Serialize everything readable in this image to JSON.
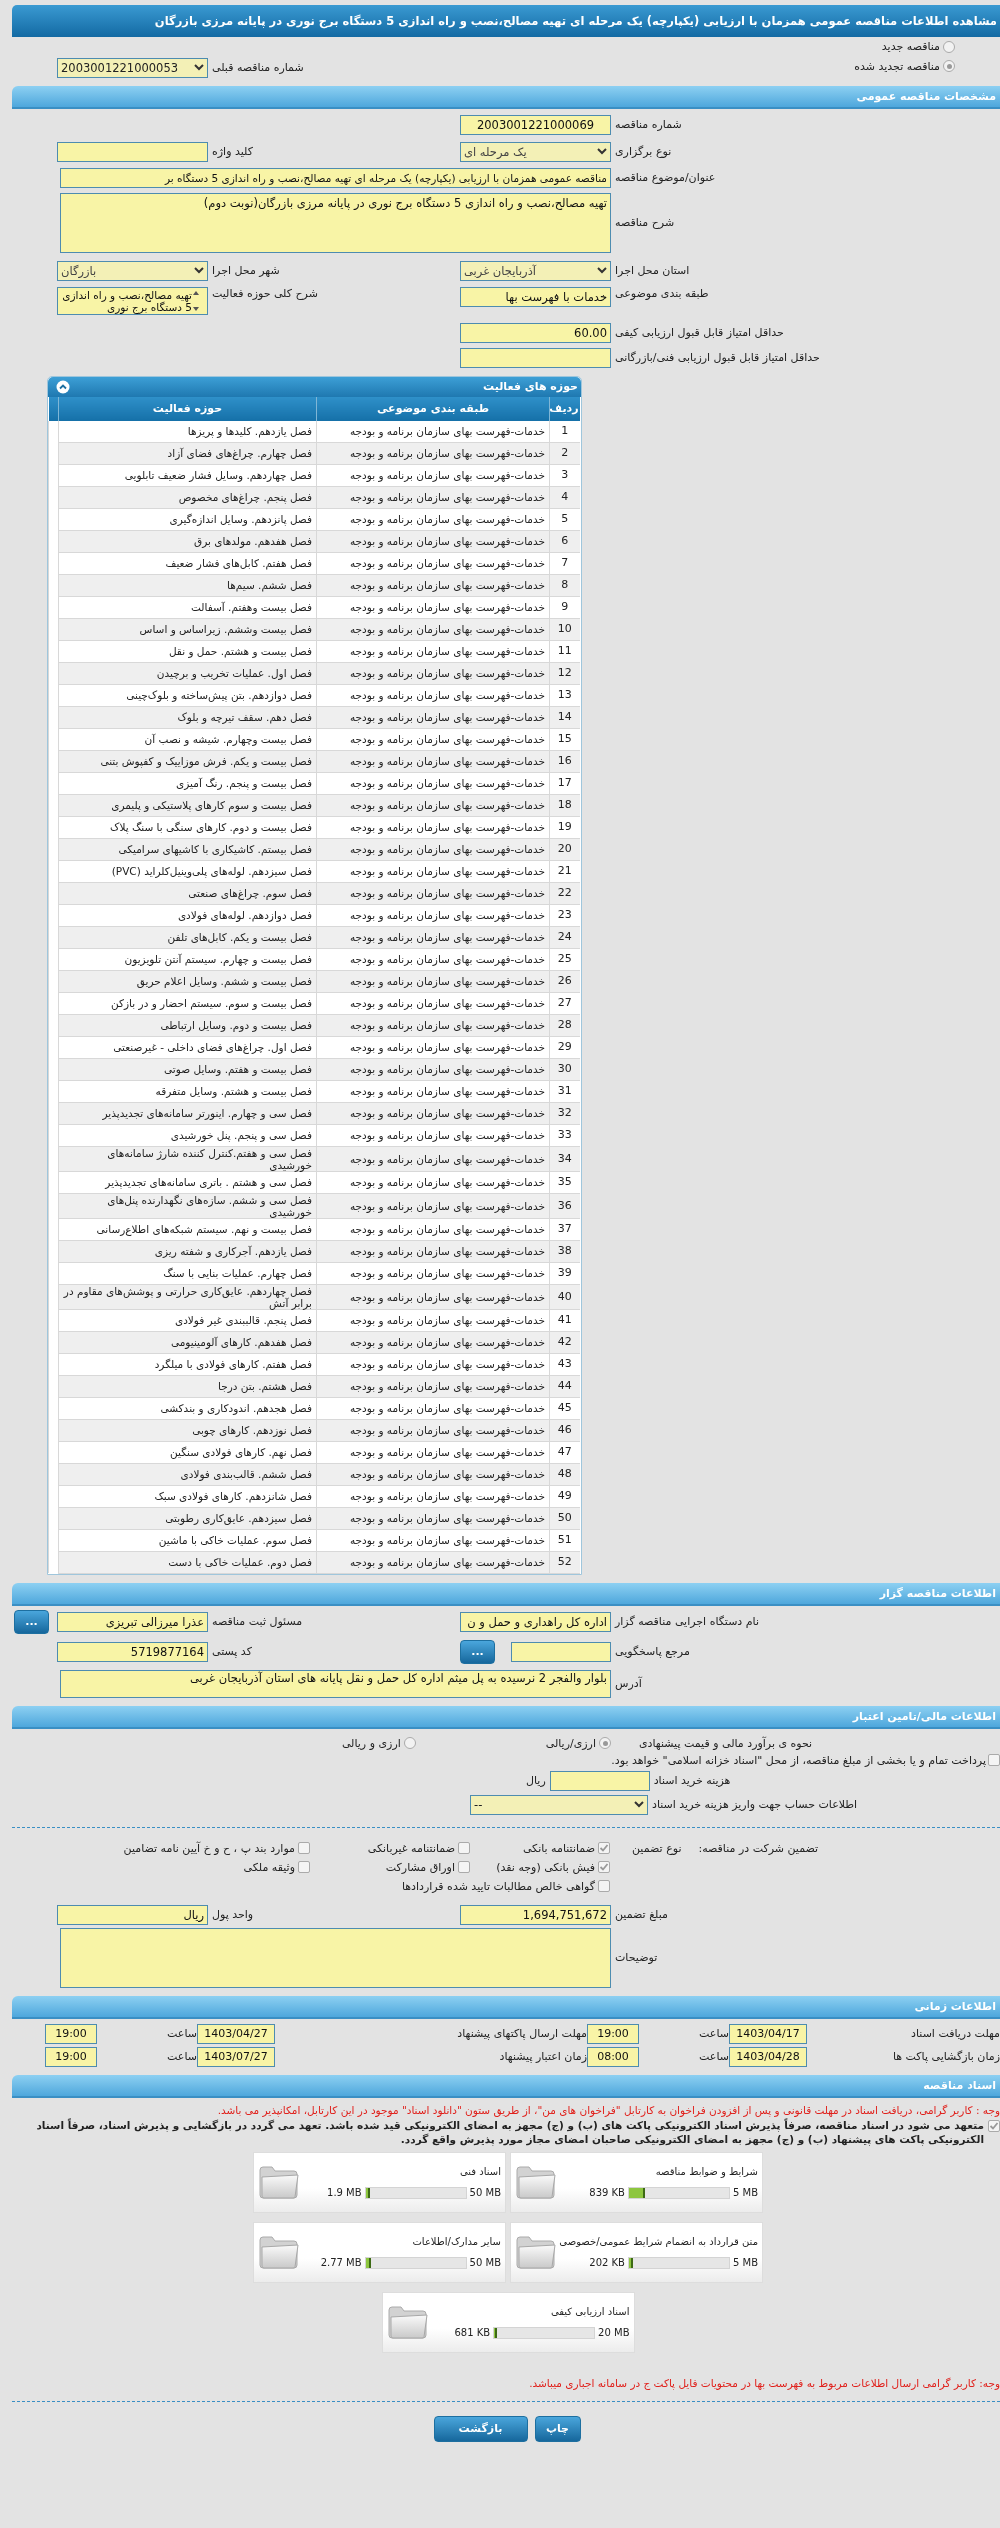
{
  "page_title": "مشاهده اطلاعات مناقصه عمومی همزمان با ارزیابی (یکپارچه) یک مرحله ای تهیه مصالح،نصب و راه اندازی 5 دستگاه برج نوری در پایانه مرزی بازرگان",
  "tender_status": [
    {
      "label": "مناقصه جدید",
      "selected": false
    },
    {
      "label": "مناقصه تجدید شده",
      "selected": true
    }
  ],
  "previous_tender": {
    "label": "شماره مناقصه قبلی",
    "value": "2003001221000053"
  },
  "general": {
    "title": "مشخصات مناقصه عمومی",
    "tender_number": {
      "label": "شماره مناقصه",
      "value": "2003001221000069"
    },
    "holding_type": {
      "label": "نوع برگزاری",
      "value": "یک مرحله ای"
    },
    "keyword": {
      "label": "کلید واژه"
    },
    "subject": {
      "label": "عنوان/موضوع مناقصه",
      "value": "مناقصه عمومی همزمان با ارزیابی (یکپارچه) یک مرحله ای تهیه مصالح،نصب و راه اندازی 5 دستگاه بر"
    },
    "description": {
      "label": "شرح مناقصه",
      "value": "تهیه مصالح،نصب و راه اندازی 5 دستگاه برج نوری در پایانه مرزی بازرگان(نوبت دوم)"
    },
    "province": {
      "label": "استان محل اجرا",
      "value": "آذربایجان غربی"
    },
    "city": {
      "label": "شهر محل اجرا",
      "value": "بازرگان"
    },
    "category": {
      "label": "طبقه بندی موضوعی",
      "value": "خدمات با فهرست بها"
    },
    "activity_summary": {
      "label": "شرح کلی حوزه فعالیت",
      "value": "تهیه مصالح،نصب و راه اندازی 5 دستگاه برج نوری"
    },
    "min_quality_score": {
      "label": "حداقل امتیاز قابل قبول ارزیابی کیفی",
      "value": "60.00"
    },
    "min_technical_score": {
      "label": "حداقل امتیاز قابل قبول ارزیابی فنی/بازرگانی"
    }
  },
  "activities": {
    "title": "حوزه های فعالیت",
    "columns": [
      "ردیف",
      "طبقه بندی موضوعی",
      "حوزه فعالیت"
    ],
    "rows": [
      {
        "index": "1",
        "category": "خدمات-فهرست بهای سازمان برنامه و بودجه",
        "activity": "فصل یازدهم. کلیدها و پریزها"
      },
      {
        "index": "2",
        "category": "خدمات-فهرست بهای سازمان برنامه و بودجه",
        "activity": "فصل چهارم. چراغ‌های فضای آزاد"
      },
      {
        "index": "3",
        "category": "خدمات-فهرست بهای سازمان برنامه و بودجه",
        "activity": "فصل چهاردهم. وسایل فشار ضعیف تابلویی"
      },
      {
        "index": "4",
        "category": "خدمات-فهرست بهای سازمان برنامه و بودجه",
        "activity": "فصل پنجم. چراغ‌های مخصوص"
      },
      {
        "index": "5",
        "category": "خدمات-فهرست بهای سازمان برنامه و بودجه",
        "activity": "فصل پانزدهم. وسایل اندازه‌گیری"
      },
      {
        "index": "6",
        "category": "خدمات-فهرست بهای سازمان برنامه و بودجه",
        "activity": "فصل هفدهم. مولدهای برق"
      },
      {
        "index": "7",
        "category": "خدمات-فهرست بهای سازمان برنامه و بودجه",
        "activity": "فصل هفتم. کابل‌های فشار ضعیف"
      },
      {
        "index": "8",
        "category": "خدمات-فهرست بهای سازمان برنامه و بودجه",
        "activity": "فصل ششم. سیم‌ها"
      },
      {
        "index": "9",
        "category": "خدمات-فهرست بهای سازمان برنامه و بودجه",
        "activity": "فصل بیست وهفتم. آسفالت"
      },
      {
        "index": "10",
        "category": "خدمات-فهرست بهای سازمان برنامه و بودجه",
        "activity": "فصل بیست وششم. زیراساس و اساس"
      },
      {
        "index": "11",
        "category": "خدمات-فهرست بهای سازمان برنامه و بودجه",
        "activity": "فصل بیست و هشتم. حمل و نقل"
      },
      {
        "index": "12",
        "category": "خدمات-فهرست بهای سازمان برنامه و بودجه",
        "activity": "فصل اول. عملیات تخریب و برچیدن"
      },
      {
        "index": "13",
        "category": "خدمات-فهرست بهای سازمان برنامه و بودجه",
        "activity": "فصل دوازدهم. بتن پیش‌ساخته و بلوک‌چینی"
      },
      {
        "index": "14",
        "category": "خدمات-فهرست بهای سازمان برنامه و بودجه",
        "activity": "فصل دهم. سقف تیرچه و بلوک"
      },
      {
        "index": "15",
        "category": "خدمات-فهرست بهای سازمان برنامه و بودجه",
        "activity": "فصل بیست وچهارم. شیشه و نصب آن"
      },
      {
        "index": "16",
        "category": "خدمات-فهرست بهای سازمان برنامه و بودجه",
        "activity": "فصل بیست و یکم. فرش موزاییک و کفپوش بتنی"
      },
      {
        "index": "17",
        "category": "خدمات-فهرست بهای سازمان برنامه و بودجه",
        "activity": "فصل بیست و پنجم. رنگ آمیزی"
      },
      {
        "index": "18",
        "category": "خدمات-فهرست بهای سازمان برنامه و بودجه",
        "activity": "فصل بیست و سوم کارهای پلاستیکی و پلیمری"
      },
      {
        "index": "19",
        "category": "خدمات-فهرست بهای سازمان برنامه و بودجه",
        "activity": "فصل بیست و دوم. کارهای سنگی با سنگ پلاک"
      },
      {
        "index": "20",
        "category": "خدمات-فهرست بهای سازمان برنامه و بودجه",
        "activity": "فصل بیستم. کاشیکاری با کاشیهای سرامیکی"
      },
      {
        "index": "21",
        "category": "خدمات-فهرست بهای سازمان برنامه و بودجه",
        "activity": "فصل سیزدهم. لوله‌های پلی‌وینیل‌کلراید (PVC)"
      },
      {
        "index": "22",
        "category": "خدمات-فهرست بهای سازمان برنامه و بودجه",
        "activity": "فصل سوم. چراغ‌های صنعتی"
      },
      {
        "index": "23",
        "category": "خدمات-فهرست بهای سازمان برنامه و بودجه",
        "activity": "فصل دوازدهم. لوله‌های فولادی"
      },
      {
        "index": "24",
        "category": "خدمات-فهرست بهای سازمان برنامه و بودجه",
        "activity": "فصل بیست و یکم. کابل‌های تلفن"
      },
      {
        "index": "25",
        "category": "خدمات-فهرست بهای سازمان برنامه و بودجه",
        "activity": "فصل بیست و چهارم. سیستم آنتن تلویزیون"
      },
      {
        "index": "26",
        "category": "خدمات-فهرست بهای سازمان برنامه و بودجه",
        "activity": "فصل بیست و ششم. وسایل اعلام حریق"
      },
      {
        "index": "27",
        "category": "خدمات-فهرست بهای سازمان برنامه و بودجه",
        "activity": "فصل بیست و سوم. سیستم احضار و در بازکن"
      },
      {
        "index": "28",
        "category": "خدمات-فهرست بهای سازمان برنامه و بودجه",
        "activity": "فصل بیست و دوم. وسایل ارتباطی"
      },
      {
        "index": "29",
        "category": "خدمات-فهرست بهای سازمان برنامه و بودجه",
        "activity": "فصل اول. چراغ‌های فضای داخلی - غیرصنعتی"
      },
      {
        "index": "30",
        "category": "خدمات-فهرست بهای سازمان برنامه و بودجه",
        "activity": "فصل بیست و هفتم. وسایل صوتی"
      },
      {
        "index": "31",
        "category": "خدمات-فهرست بهای سازمان برنامه و بودجه",
        "activity": "فصل بیست و هشتم. وسایل متفرقه"
      },
      {
        "index": "32",
        "category": "خدمات-فهرست بهای سازمان برنامه و بودجه",
        "activity": "فصل سی و چهارم. اینورتر سامانه‌های تجدیدپذیر"
      },
      {
        "index": "33",
        "category": "خدمات-فهرست بهای سازمان برنامه و بودجه",
        "activity": "فصل سی و پنجم. پنل خورشیدی"
      },
      {
        "index": "34",
        "category": "خدمات-فهرست بهای سازمان برنامه و بودجه",
        "activity": "فصل سی و هفتم.کنترل کننده شارژ سامانه‌های خورشیدی"
      },
      {
        "index": "35",
        "category": "خدمات-فهرست بهای سازمان برنامه و بودجه",
        "activity": "فصل سی و هشتم . باتری سامانه‌های تجدیدپذیر"
      },
      {
        "index": "36",
        "category": "خدمات-فهرست بهای سازمان برنامه و بودجه",
        "activity": "فصل سی و ششم. سازه‌های نگهدارنده پنل‌های خورشیدی"
      },
      {
        "index": "37",
        "category": "خدمات-فهرست بهای سازمان برنامه و بودجه",
        "activity": "فصل بیست و نهم. سیستم شبکه‌های اطلاع‌رسانی"
      },
      {
        "index": "38",
        "category": "خدمات-فهرست بهای سازمان برنامه و بودجه",
        "activity": "فصل یازدهم. آجرکاری و شفته ریزی"
      },
      {
        "index": "39",
        "category": "خدمات-فهرست بهای سازمان برنامه و بودجه",
        "activity": "فصل چهارم. عملیات بنایی با سنگ"
      },
      {
        "index": "40",
        "category": "خدمات-فهرست بهای سازمان برنامه و بودجه",
        "activity": "فصل چهاردهم. عایق‌کاری حرارتی و پوشش‌های مقاوم در برابر آتش"
      },
      {
        "index": "41",
        "category": "خدمات-فهرست بهای سازمان برنامه و بودجه",
        "activity": "فصل پنجم. قالببندی غیر فولادی"
      },
      {
        "index": "42",
        "category": "خدمات-فهرست بهای سازمان برنامه و بودجه",
        "activity": "فصل هفدهم. کارهای آلومینیومی"
      },
      {
        "index": "43",
        "category": "خدمات-فهرست بهای سازمان برنامه و بودجه",
        "activity": "فصل هفتم. کارهای فولادی با میلگرد"
      },
      {
        "index": "44",
        "category": "خدمات-فهرست بهای سازمان برنامه و بودجه",
        "activity": "فصل هشتم. بتن درجا"
      },
      {
        "index": "45",
        "category": "خدمات-فهرست بهای سازمان برنامه و بودجه",
        "activity": "فصل هجدهم. اندودکاری و بندکشی"
      },
      {
        "index": "46",
        "category": "خدمات-فهرست بهای سازمان برنامه و بودجه",
        "activity": "فصل نوزدهم. کارهای چوبی"
      },
      {
        "index": "47",
        "category": "خدمات-فهرست بهای سازمان برنامه و بودجه",
        "activity": "فصل نهم. کارهای فولادی سنگین"
      },
      {
        "index": "48",
        "category": "خدمات-فهرست بهای سازمان برنامه و بودجه",
        "activity": "فصل ششم. قالب‌بندی فولادی"
      },
      {
        "index": "49",
        "category": "خدمات-فهرست بهای سازمان برنامه و بودجه",
        "activity": "فصل شانزدهم. کارهای فولادی سبک"
      },
      {
        "index": "50",
        "category": "خدمات-فهرست بهای سازمان برنامه و بودجه",
        "activity": "فصل سیزدهم. عایق‌کاری رطوبتی"
      },
      {
        "index": "51",
        "category": "خدمات-فهرست بهای سازمان برنامه و بودجه",
        "activity": "فصل سوم. عملیات خاکی با ماشین"
      },
      {
        "index": "52",
        "category": "خدمات-فهرست بهای سازمان برنامه و بودجه",
        "activity": "فصل دوم. عملیات خاکی با دست"
      }
    ]
  },
  "organizer": {
    "title": "اطلاعات مناقصه گزار",
    "agency": {
      "label": "نام دستگاه اجرایی مناقصه گزار",
      "value": "اداره کل راهداری و حمل و ن"
    },
    "registrar": {
      "label": "مسئول ثبت مناقصه",
      "value": "عذرا میرزالی تبریزی",
      "button": "..."
    },
    "response_ref": {
      "label": "مرجع پاسخگویی",
      "button": "..."
    },
    "postal_code": {
      "label": "کد پستی",
      "value": "5719877164"
    },
    "address": {
      "label": "آدرس",
      "value": "بلوار والفجر 2 نرسیده به پل میثم اداره کل حمل و نقل پایانه های استان آذربایجان غربی"
    }
  },
  "finance": {
    "title": "اطلاعات مالی/تامین اعتبار",
    "estimation": {
      "label": "نحوه ی برآورد مالی و قیمت پیشنهادی",
      "options": [
        {
          "label": "ارزی/ریالی",
          "selected": true
        },
        {
          "label": "ارزی و ریالی",
          "selected": false
        }
      ]
    },
    "treasury": {
      "label": "پرداخت تمام و یا بخشی از مبلغ مناقصه، از محل \"اسناد خزانه اسلامی\" خواهد بود.",
      "checked": false
    },
    "document_fee": {
      "label": "هزینه خرید اسناد",
      "unit": "ریال"
    },
    "fee_account": {
      "label": "اطلاعات حساب جهت واریز هزینه خرید اسناد",
      "value": "--"
    },
    "guarantee": {
      "label": "تضمین شرکت در مناقصه:",
      "type_label": "نوع تضمین",
      "options": [
        {
          "label": "ضمانتنامه بانکی",
          "checked": true
        },
        {
          "label": "ضمانتنامه غیربانکی",
          "checked": false
        },
        {
          "label": "موارد بند پ ، ح و خ آیین نامه تضامین",
          "checked": false
        },
        {
          "label": "فیش بانکی (وجه نقد)",
          "checked": true
        },
        {
          "label": "اوراق مشارکت",
          "checked": false
        },
        {
          "label": "وثیقه ملکی",
          "checked": false
        },
        {
          "label": "گواهی خالص مطالبات تایید شده قراردادها",
          "checked": false
        }
      ]
    },
    "amount": {
      "label": "مبلغ تضمین",
      "value": "1,694,751,672"
    },
    "currency": {
      "label": "واحد پول",
      "value": "ریال"
    },
    "notes": {
      "label": "توضیحات"
    }
  },
  "timing": {
    "title": "اطلاعات زمانی",
    "items": [
      {
        "label": "مهلت دریافت اسناد",
        "date": "1403/04/17",
        "time_label": "ساعت",
        "time": "19:00"
      },
      {
        "label": "مهلت ارسال پاکتهای پیشنهاد",
        "date": "1403/04/27",
        "time_label": "ساعت",
        "time": "19:00"
      },
      {
        "label": "زمان بازگشایی پاکت ها",
        "date": "1403/04/28",
        "time_label": "ساعت",
        "time": "08:00"
      },
      {
        "label": "زمان اعتبار پیشنهاد",
        "date": "1403/07/27",
        "time_label": "ساعت",
        "time": "19:00"
      }
    ]
  },
  "documents": {
    "title": "اسناد مناقصه",
    "notice": "وجه : کاربر گرامی، دریافت اسناد در مهلت قانونی و پس از افزودن فراخوان به کارتابل \"فراخوان های من\"، از طریق ستون \"دانلود اسناد\" موجود در این کارتابل، امکانپذیر می باشد.",
    "commitment": {
      "label": "متعهد می شود در اسناد مناقصه، صرفاً پذیرش اسناد الکترونیکی پاکت های (ب) و (ج) مجهز به امضای الکترونیکی قید شده باشد. تعهد می گردد در بازگشایی و پذیرش اسناد، صرفاً اسناد الکترونیکی پاکت های پیشنهاد (ب) و (ج) مجهز به امضای الکترونیکی صاحبان امضای مجاز مورد پذیرش واقع گردد.",
      "checked": true
    },
    "files": [
      {
        "name": "شرایط و ضوابط مناقصه",
        "size": "839 KB",
        "limit": "5 MB",
        "level": 0.16
      },
      {
        "name": "اسناد فنی",
        "size": "1.9 MB",
        "limit": "50 MB",
        "level": 0.04
      },
      {
        "name": "متن قرارداد به انضمام شرایط عمومی/خصوصی",
        "size": "202 KB",
        "limit": "5 MB",
        "level": 0.04
      },
      {
        "name": "سایر مدارک/اطلاعات",
        "size": "2.77 MB",
        "limit": "50 MB",
        "level": 0.055
      },
      {
        "name": "اسناد ارزیابی کیفی",
        "size": "681 KB",
        "limit": "20 MB",
        "level": 0.033
      }
    ],
    "footer_notice": "وجه: کاربر گرامی ارسال اطلاعات مربوط به فهرست بها در محتویات فایل پاکت ج در سامانه اجباری میباشد."
  },
  "buttons": [
    {
      "label": "چاپ"
    },
    {
      "label": "بازگشت"
    }
  ]
}
